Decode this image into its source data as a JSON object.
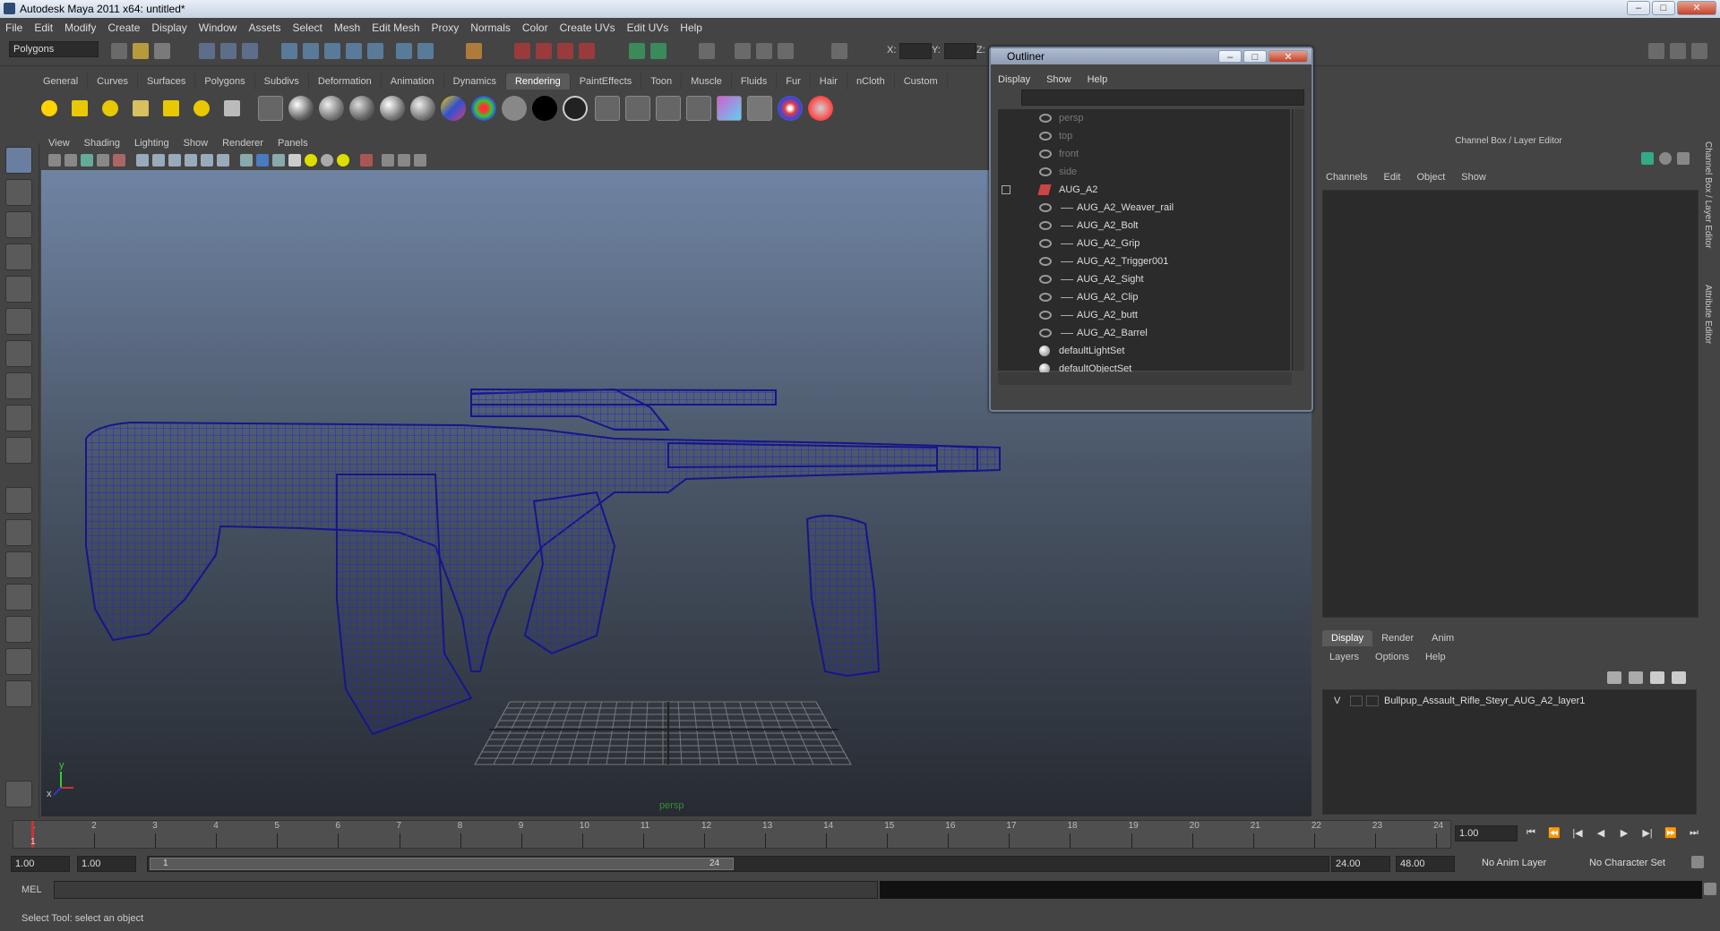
{
  "window": {
    "title": "Autodesk Maya 2011 x64: untitled*",
    "min": "–",
    "max": "□",
    "close": "✕"
  },
  "menubar": [
    "File",
    "Edit",
    "Modify",
    "Create",
    "Display",
    "Window",
    "Assets",
    "Select",
    "Mesh",
    "Edit Mesh",
    "Proxy",
    "Normals",
    "Color",
    "Create UVs",
    "Edit UVs",
    "Help"
  ],
  "statusline": {
    "mode": "Polygons",
    "x_label": "X:",
    "y_label": "Y:",
    "z_label": "Z:"
  },
  "shelf_tabs": [
    "General",
    "Curves",
    "Surfaces",
    "Polygons",
    "Subdivs",
    "Deformation",
    "Animation",
    "Dynamics",
    "Rendering",
    "PaintEffects",
    "Toon",
    "Muscle",
    "Fluids",
    "Fur",
    "Hair",
    "nCloth",
    "Custom"
  ],
  "shelf_active": "Rendering",
  "panel_menu": [
    "View",
    "Shading",
    "Lighting",
    "Show",
    "Renderer",
    "Panels"
  ],
  "viewport": {
    "camera": "persp",
    "axis_y": "y",
    "axis_x": "x",
    "wire_color": "#1b1b8f"
  },
  "outliner": {
    "title": "Outliner",
    "menu": [
      "Display",
      "Show",
      "Help"
    ],
    "items": [
      {
        "label": "persp",
        "dim": true,
        "indent": 0
      },
      {
        "label": "top",
        "dim": true,
        "indent": 0
      },
      {
        "label": "front",
        "dim": true,
        "indent": 0
      },
      {
        "label": "side",
        "dim": true,
        "indent": 0
      },
      {
        "label": "AUG_A2",
        "dim": false,
        "indent": 0,
        "group": true
      },
      {
        "label": "AUG_A2_Weaver_rail",
        "dim": false,
        "indent": 1
      },
      {
        "label": "AUG_A2_Bolt",
        "dim": false,
        "indent": 1
      },
      {
        "label": "AUG_A2_Grip",
        "dim": false,
        "indent": 1
      },
      {
        "label": "AUG_A2_Trigger001",
        "dim": false,
        "indent": 1
      },
      {
        "label": "AUG_A2_Sight",
        "dim": false,
        "indent": 1
      },
      {
        "label": "AUG_A2_Clip",
        "dim": false,
        "indent": 1
      },
      {
        "label": "AUG_A2_butt",
        "dim": false,
        "indent": 1
      },
      {
        "label": "AUG_A2_Barrel",
        "dim": false,
        "indent": 1
      },
      {
        "label": "defaultLightSet",
        "dim": false,
        "indent": 0,
        "set": true
      },
      {
        "label": "defaultObjectSet",
        "dim": false,
        "indent": 0,
        "set": true
      }
    ]
  },
  "channel_box": {
    "title": "Channel Box / Layer Editor",
    "menu": [
      "Channels",
      "Edit",
      "Object",
      "Show"
    ]
  },
  "right_strip": {
    "tab1": "Channel Box / Layer Editor",
    "tab2": "Attribute Editor"
  },
  "layer_editor": {
    "tabs": [
      "Display",
      "Render",
      "Anim"
    ],
    "active": "Display",
    "menu": [
      "Layers",
      "Options",
      "Help"
    ],
    "layer": {
      "visible": "V",
      "name": "Bullpup_Assault_Rifle_Steyr_AUG_A2_layer1"
    }
  },
  "time_slider": {
    "ticks": [
      "1",
      "2",
      "3",
      "4",
      "5",
      "6",
      "7",
      "8",
      "9",
      "10",
      "11",
      "12",
      "13",
      "14",
      "15",
      "16",
      "17",
      "18",
      "19",
      "20",
      "21",
      "22",
      "23",
      "24"
    ],
    "current_frame_marker": "1",
    "current_time": "1.00"
  },
  "range_slider": {
    "start_time": "1.00",
    "playback_start": "1.00",
    "range_start_label": "1",
    "range_end_label": "24",
    "playback_end": "24.00",
    "end_time": "48.00",
    "anim_layer": "No Anim Layer",
    "char_set": "No Character Set"
  },
  "command_line": {
    "label": "MEL"
  },
  "help_line": {
    "text": "Select Tool: select an object"
  },
  "playback": [
    "⏮",
    "⏪",
    "|◀",
    "◀",
    "▶",
    "▶|",
    "⏩",
    "⏭"
  ]
}
